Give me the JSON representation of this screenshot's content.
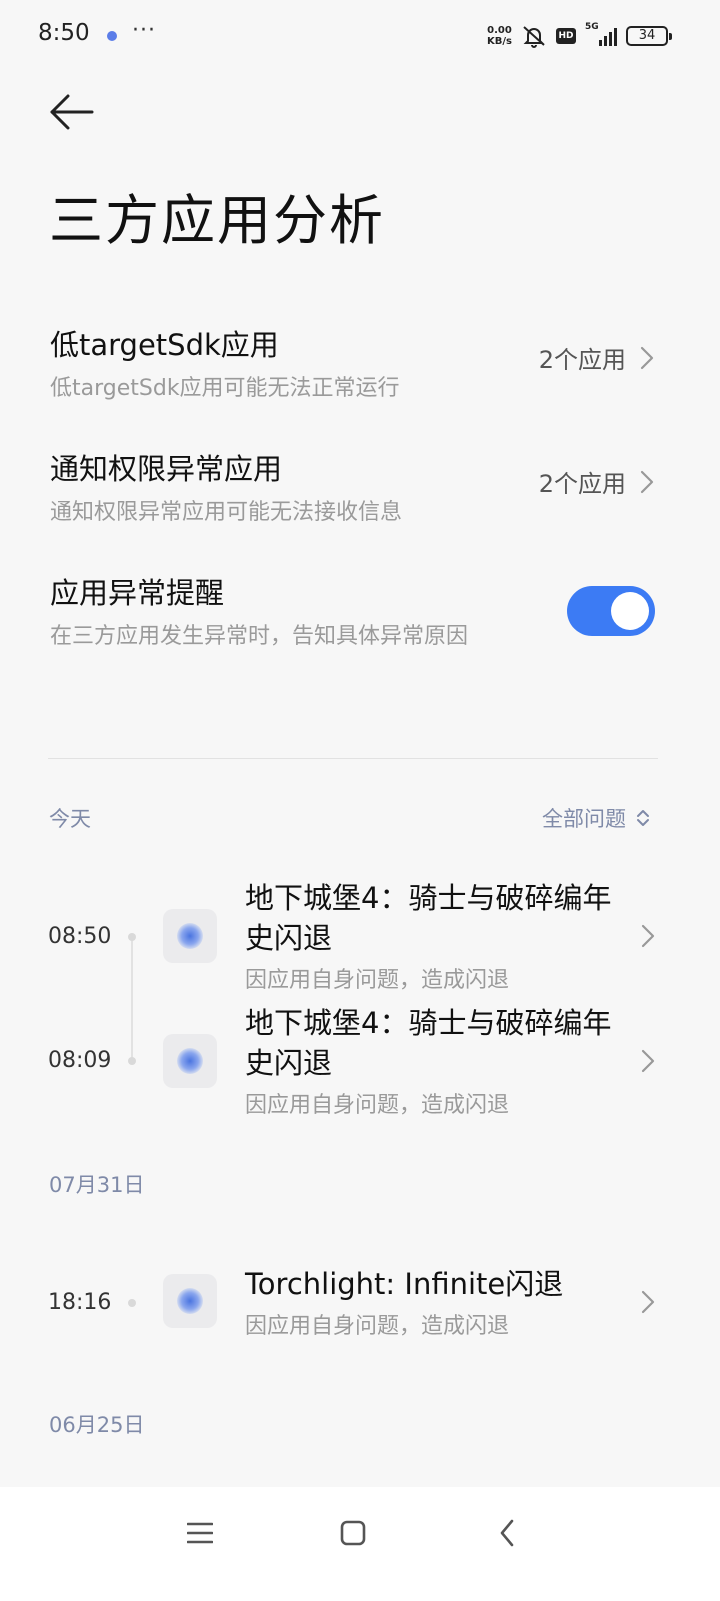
{
  "status_bar": {
    "time": "8:50",
    "more": "···",
    "net_speed_value": "0.00",
    "net_speed_unit": "KB/s",
    "hd_label": "HD",
    "network": "5G",
    "battery": "34"
  },
  "header": {
    "title": "三方应用分析"
  },
  "settings": {
    "low_target_sdk": {
      "title": "低targetSdk应用",
      "subtitle": "低targetSdk应用可能无法正常运行",
      "value": "2个应用"
    },
    "notification_permission": {
      "title": "通知权限异常应用",
      "subtitle": "通知权限异常应用可能无法接收信息",
      "value": "2个应用"
    },
    "exception_alert": {
      "title": "应用异常提醒",
      "subtitle": "在三方应用发生异常时，告知具体异常原因",
      "enabled": true
    }
  },
  "filter": {
    "label": "全部问题"
  },
  "sections": [
    {
      "date": "今天",
      "events": [
        {
          "time": "08:50",
          "title": "地下城堡4：骑士与破碎编年史闪退",
          "subtitle": "因应用自身问题，造成闪退"
        },
        {
          "time": "08:09",
          "title": "地下城堡4：骑士与破碎编年史闪退",
          "subtitle": "因应用自身问题，造成闪退"
        }
      ]
    },
    {
      "date": "07月31日",
      "events": [
        {
          "time": "18:16",
          "title": "Torchlight: Infinite闪退",
          "subtitle": "因应用自身问题，造成闪退"
        }
      ]
    },
    {
      "date": "06月25日",
      "events": []
    }
  ],
  "colors": {
    "accent": "#3c7bf4",
    "background": "#f7f7f7",
    "secondary_text": "#9a9a9a",
    "section_label": "#7f8aa8"
  }
}
